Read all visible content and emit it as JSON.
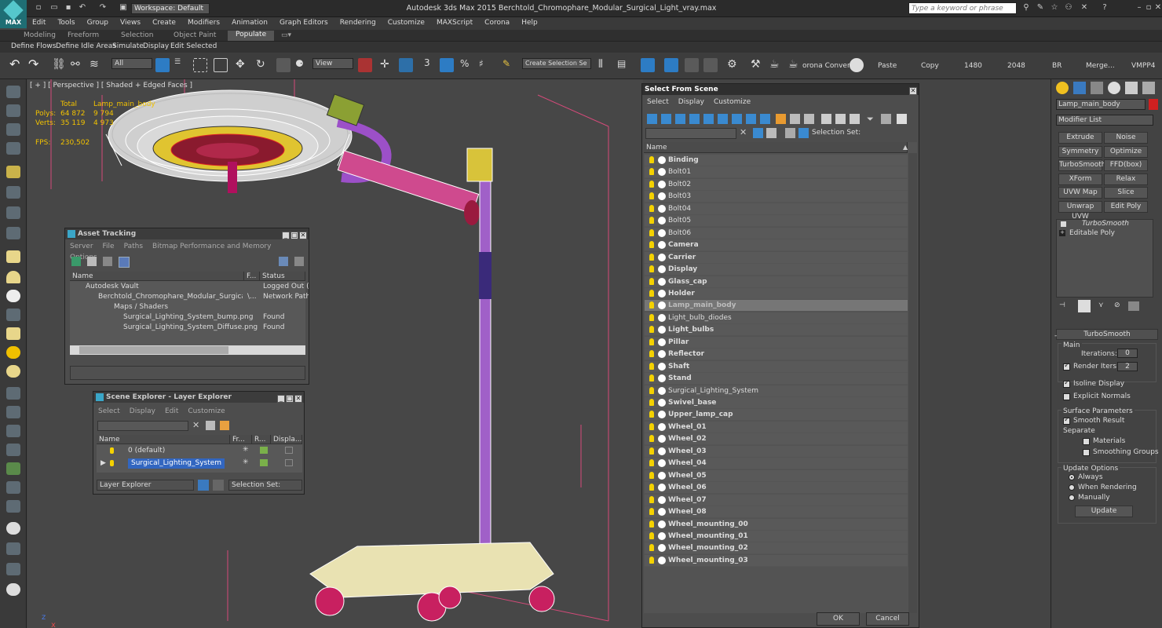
{
  "app": {
    "logo_label": "MAX",
    "title": "Autodesk 3ds Max  2015     Berchtold_Chromophare_Modular_Surgical_Light_vray.max",
    "workspace": "Workspace: Default",
    "search_placeholder": "Type a keyword or phrase"
  },
  "menu": [
    "Edit",
    "Tools",
    "Group",
    "Views",
    "Create",
    "Modifiers",
    "Animation",
    "Graph Editors",
    "Rendering",
    "Customize",
    "MAXScript",
    "Corona",
    "Help"
  ],
  "ribbon_tabs": [
    "Modeling",
    "Freeform",
    "Selection",
    "Object Paint",
    "Populate"
  ],
  "ribbon_items": [
    "Define Flows",
    "Define Idle Areas",
    "Simulate",
    "Display",
    "Edit Selected"
  ],
  "toolbar": {
    "filter": "All",
    "refcoord": "View",
    "snap_num": "3",
    "selection_set": "Create Selection Se",
    "corona_convert": "orona Convert",
    "paste": "Paste",
    "copy": "Copy",
    "w1480": "1480",
    "w2048": "2048",
    "br": "BR",
    "merge": "Merge...",
    "vmpp": "VMPP4"
  },
  "viewport": {
    "label": "[ + ] [ Perspective ] [ Shaded + Edged Faces ]",
    "stats": {
      "col_total": "Total",
      "col_obj": "Lamp_main_body",
      "polys_label": "Polys:",
      "polys_total": "64 872",
      "polys_obj": "9 794",
      "verts_label": "Verts:",
      "verts_total": "35 119",
      "verts_obj": "4 973",
      "fps_label": "FPS:",
      "fps_value": "230,502"
    },
    "axis_z": "z",
    "axis_x": "x"
  },
  "asset_tracking": {
    "title": "Asset Tracking",
    "menu": [
      "Server",
      "File",
      "Paths",
      "Bitmap Performance and Memory",
      "Options"
    ],
    "headers": [
      "Name",
      "F...",
      "Status"
    ],
    "rows": [
      {
        "name": "Autodesk Vault",
        "f": "",
        "status": "Logged Out (..."
      },
      {
        "name": "Berchtold_Chromophare_Modular_Surgical_Li...",
        "f": "\\...",
        "status": "Network Path"
      },
      {
        "name": "Maps / Shaders",
        "f": "",
        "status": ""
      },
      {
        "name": "Surgical_Lighting_System_bump.png",
        "f": "",
        "status": "Found"
      },
      {
        "name": "Surgical_Lighting_System_Diffuse.png",
        "f": "",
        "status": "Found"
      }
    ]
  },
  "scene_explorer": {
    "title": "Scene Explorer - Layer Explorer",
    "menu": [
      "Select",
      "Display",
      "Edit",
      "Customize"
    ],
    "headers": [
      "Name",
      "Fr...",
      "R...",
      "Displa..."
    ],
    "rows": [
      "0 (default)",
      "Surgical_Lighting_System"
    ],
    "footer_mode": "Layer Explorer",
    "footer_selset": "Selection Set:"
  },
  "select_from_scene": {
    "title": "Select From Scene",
    "menu": [
      "Select",
      "Display",
      "Customize"
    ],
    "selection_set": "Selection Set:",
    "header": "Name",
    "objects": [
      {
        "name": "Binding",
        "bold": true
      },
      {
        "name": "Bolt01",
        "bold": false
      },
      {
        "name": "Bolt02",
        "bold": false
      },
      {
        "name": "Bolt03",
        "bold": false
      },
      {
        "name": "Bolt04",
        "bold": false
      },
      {
        "name": "Bolt05",
        "bold": false
      },
      {
        "name": "Bolt06",
        "bold": false
      },
      {
        "name": "Camera",
        "bold": true
      },
      {
        "name": "Carrier",
        "bold": true
      },
      {
        "name": "Display",
        "bold": true
      },
      {
        "name": "Glass_cap",
        "bold": true
      },
      {
        "name": "Holder",
        "bold": true
      },
      {
        "name": "Lamp_main_body",
        "bold": true,
        "selected": true
      },
      {
        "name": "Light_bulb_diodes",
        "bold": false
      },
      {
        "name": "Light_bulbs",
        "bold": true
      },
      {
        "name": "Pillar",
        "bold": true
      },
      {
        "name": "Reflector",
        "bold": true
      },
      {
        "name": "Shaft",
        "bold": true
      },
      {
        "name": "Stand",
        "bold": true
      },
      {
        "name": "Surgical_Lighting_System",
        "bold": false
      },
      {
        "name": "Swivel_base",
        "bold": true
      },
      {
        "name": "Upper_lamp_cap",
        "bold": true
      },
      {
        "name": "Wheel_01",
        "bold": true
      },
      {
        "name": "Wheel_02",
        "bold": true
      },
      {
        "name": "Wheel_03",
        "bold": true
      },
      {
        "name": "Wheel_04",
        "bold": true
      },
      {
        "name": "Wheel_05",
        "bold": true
      },
      {
        "name": "Wheel_06",
        "bold": true
      },
      {
        "name": "Wheel_07",
        "bold": true
      },
      {
        "name": "Wheel_08",
        "bold": true
      },
      {
        "name": "Wheel_mounting_00",
        "bold": true
      },
      {
        "name": "Wheel_mounting_01",
        "bold": true
      },
      {
        "name": "Wheel_mounting_02",
        "bold": true
      },
      {
        "name": "Wheel_mounting_03",
        "bold": true
      }
    ],
    "ok": "OK",
    "cancel": "Cancel"
  },
  "command_panel": {
    "object_name": "Lamp_main_body",
    "modifier_list": "Modifier List",
    "buttons": [
      "Extrude",
      "Noise",
      "Symmetry",
      "Optimize",
      "TurboSmooth",
      "FFD(box)",
      "XForm",
      "Relax",
      "UVW Map",
      "Slice",
      "Unwrap UVW",
      "Edit Poly"
    ],
    "stack": [
      "TurboSmooth",
      "Editable Poly"
    ],
    "rollout_title": "TurboSmooth",
    "main_group": "Main",
    "iterations_label": "Iterations:",
    "iterations_value": "0",
    "render_iters_label": "Render Iters:",
    "render_iters_value": "2",
    "isoline": "Isoline Display",
    "explicit_normals": "Explicit Normals",
    "surface_params": "Surface Parameters",
    "smooth_result": "Smooth Result",
    "separate": "Separate",
    "materials": "Materials",
    "smoothing_groups": "Smoothing Groups",
    "update_options": "Update Options",
    "always": "Always",
    "when_rendering": "When Rendering",
    "manually": "Manually",
    "update_btn": "Update"
  }
}
